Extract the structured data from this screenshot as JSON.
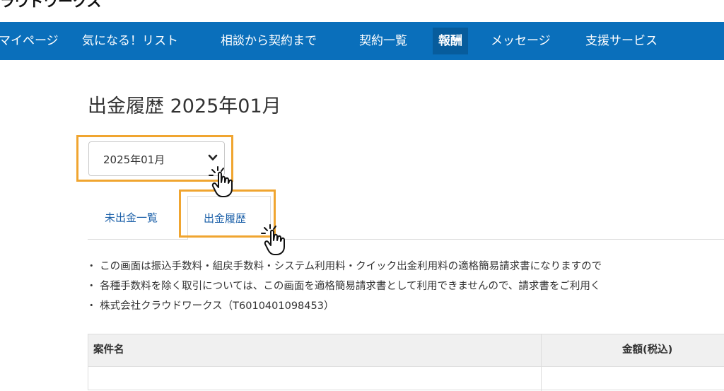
{
  "header": {
    "logo_text": "ラウドワークス"
  },
  "nav": {
    "items": [
      {
        "label": "マイページ"
      },
      {
        "label": "気になる！リスト"
      },
      {
        "label": "相談から契約まで"
      },
      {
        "label": "契約一覧"
      },
      {
        "label": "報酬"
      },
      {
        "label": "メッセージ"
      },
      {
        "label": "支援サービス"
      }
    ],
    "active_index": 4,
    "bar_color": "#0a6fbb"
  },
  "main": {
    "title": "出金履歴 2025年01月",
    "month_select": {
      "value": "2025年01月"
    },
    "tabs": [
      {
        "label": "未出金一覧"
      },
      {
        "label": "出金履歴"
      }
    ],
    "active_tab": 1,
    "notes": [
      "・ この画面は振込手数料・組戻手数料・システム利用料・クイック出金利用料の適格簡易請求書になりますので",
      "・ 各種手数料を除く取引については、この画面を適格簡易請求書として利用できませんので、請求書をご利用く",
      "・ 株式会社クラウドワークス（T6010401098453）"
    ],
    "table": {
      "columns": [
        "案件名",
        "金額(税込)"
      ]
    }
  },
  "annotations": {
    "highlight_color": "#f0a530",
    "pointer_icon": "hand-pointer-icon"
  }
}
